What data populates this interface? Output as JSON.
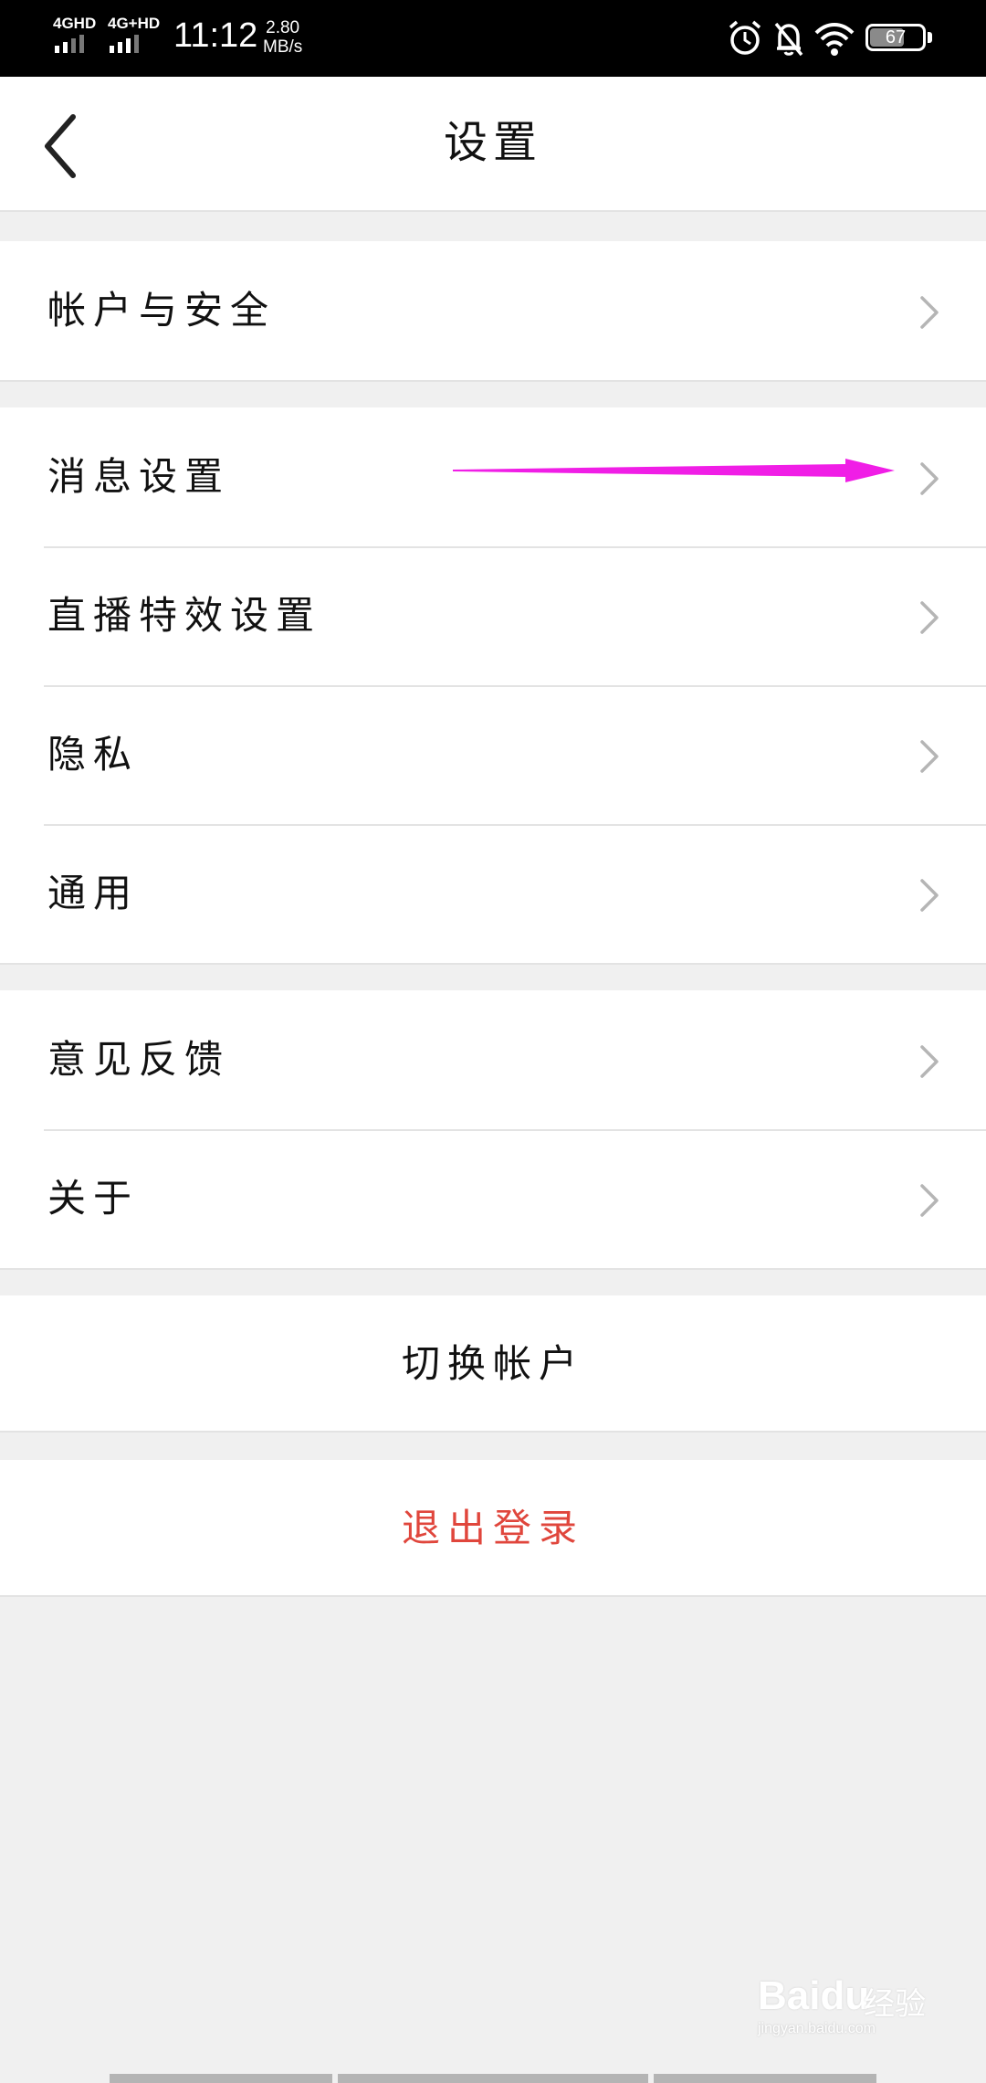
{
  "status_bar": {
    "network_1": "4GHD",
    "network_2": "4G+HD",
    "time": "11:12",
    "speed_value": "2.80",
    "speed_unit": "MB/s",
    "icons": [
      "alarm-icon",
      "bell-muted-icon",
      "wifi-icon"
    ],
    "battery_level": "67"
  },
  "nav": {
    "title": "设置",
    "back_icon": "back-chevron-icon"
  },
  "settings": {
    "group_1": [
      {
        "label": "帐户与安全"
      }
    ],
    "group_2": [
      {
        "label": "消息设置"
      },
      {
        "label": "直播特效设置"
      },
      {
        "label": "隐私"
      },
      {
        "label": "通用"
      }
    ],
    "group_3": [
      {
        "label": "意见反馈"
      },
      {
        "label": "关于"
      }
    ],
    "switch_account": "切换帐户",
    "logout": "退出登录"
  },
  "colors": {
    "logout": "#e0463c",
    "annotation_arrow": "#f01ee6",
    "background": "#f0f0f0",
    "chevron": "#b5b5b5"
  },
  "watermark": {
    "brand": "Baidu",
    "cn": "经验",
    "url": "jingyan.baidu.com"
  }
}
